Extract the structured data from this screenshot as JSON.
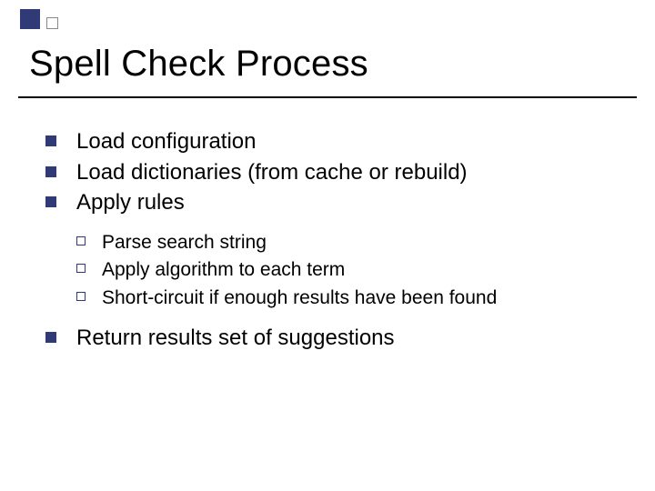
{
  "title": "Spell Check Process",
  "bullets": {
    "b0": "Load configuration",
    "b1": "Load dictionaries (from cache or rebuild)",
    "b2": "Apply rules",
    "b3": "Return results set of suggestions"
  },
  "sub": {
    "s0": "Parse search string",
    "s1": "Apply algorithm to each term",
    "s2": "Short-circuit if enough results have been found"
  }
}
